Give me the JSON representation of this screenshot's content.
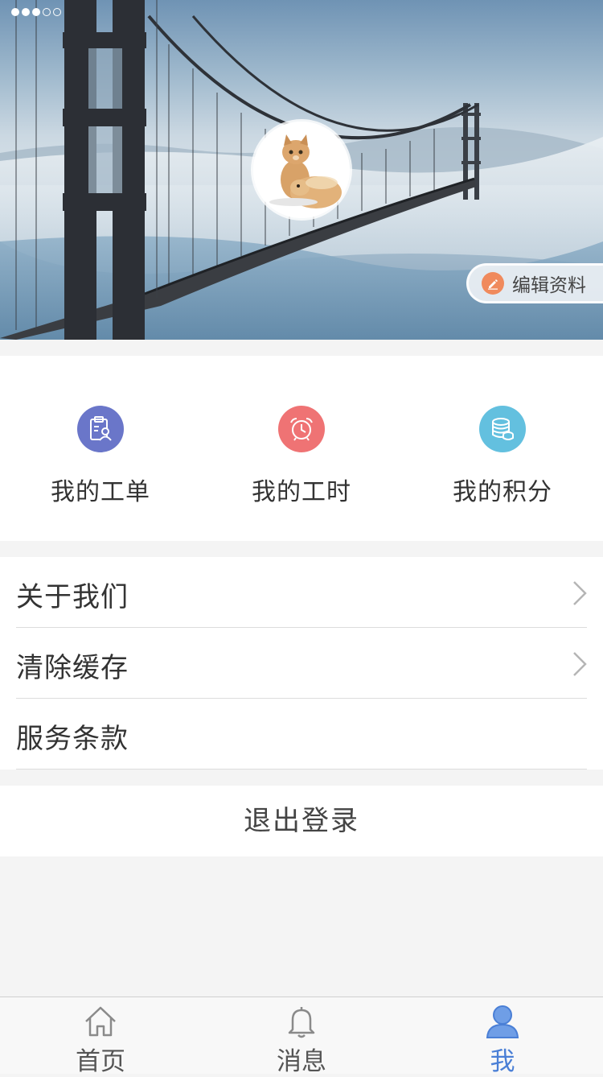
{
  "profile": {
    "edit_label": "编辑资料"
  },
  "quick_entries": [
    {
      "label": "我的工单",
      "icon": "work-order-icon",
      "color": "#6a76c9"
    },
    {
      "label": "我的工时",
      "icon": "alarm-clock-icon",
      "color": "#ef7374"
    },
    {
      "label": "我的积分",
      "icon": "coins-icon",
      "color": "#63c0df"
    }
  ],
  "menu": [
    {
      "label": "关于我们",
      "has_arrow": true
    },
    {
      "label": "清除缓存",
      "has_arrow": true
    },
    {
      "label": "服务条款",
      "has_arrow": false
    }
  ],
  "logout_label": "退出登录",
  "tabs": [
    {
      "label": "首页",
      "icon": "home-icon",
      "active": false
    },
    {
      "label": "消息",
      "icon": "bell-icon",
      "active": false
    },
    {
      "label": "我",
      "icon": "user-icon",
      "active": true
    }
  ],
  "colors": {
    "accent": "#4a7fd6",
    "edit_icon": "#f08a5d",
    "background": "#f4f4f4"
  }
}
